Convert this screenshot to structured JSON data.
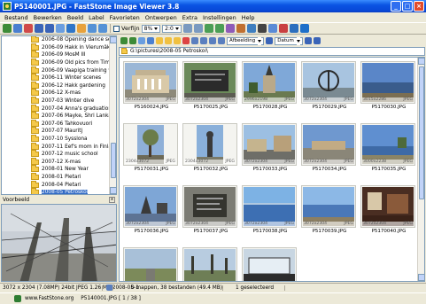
{
  "window": {
    "title": "P5140001.JPG - FastStone Image Viewer 3.8"
  },
  "menu": [
    "Bestand",
    "Bewerken",
    "Beeld",
    "Label",
    "Favorieten",
    "Ontwerpen",
    "Extra",
    "Instellingen",
    "Help"
  ],
  "toolbar": {
    "verfijn_label": "Verfijn",
    "zoom_value": "8%",
    "ratio_value": "2:0"
  },
  "tree": [
    "2006-08 Opening dance season",
    "2006-09 Hakk in Vierumäki",
    "2006-09 MosM III",
    "2006-09 Old pics from Timo's ca",
    "2006-09 Vaapiga training weeke",
    "2006-11 Winter scenes",
    "2006-12 Hakk gardening",
    "2006-12 X-mas",
    "2007-03 Winter dive",
    "2007-04 Anna's graduation",
    "2007-06 Mayke, Shri Lanka",
    "2007-06 Tahkovuori",
    "2007-07 Mauritj",
    "2007-10 Sysslona",
    "2007-11 Eef's mom in Finland",
    "2007-12 music school",
    "2007-12 X-mas",
    "2008-01 New Year",
    "2008-01 Pietari",
    "2008-04 Pietari",
    "2008-05 Petroskoi",
    "2008-05 Pietari"
  ],
  "tree_selected_index": 20,
  "preview_label": "Voorbeeld",
  "sort": {
    "primary": "Afbeelding",
    "secondary": "Datum"
  },
  "path": "G:\\pictures\\2008-05 Petroskoi\\",
  "thumbnails": [
    {
      "name": "P5160024.JPG",
      "dims": "3072x2304",
      "fmt": "JPEG",
      "kind": "building"
    },
    {
      "name": "P5170025.JPG",
      "dims": "3072x2304",
      "fmt": "JPEG",
      "kind": "plaque"
    },
    {
      "name": "P5170028.JPG",
      "dims": "2996x2198",
      "fmt": "JPEG",
      "kind": "church"
    },
    {
      "name": "P5170029.JPG",
      "dims": "3072x2304",
      "fmt": "JPEG",
      "kind": "anchor"
    },
    {
      "name": "P5170030.JPG",
      "dims": "3015x2286",
      "fmt": "JPEG",
      "kind": "lake"
    },
    {
      "name": "P5170031.JPG",
      "dims": "2304x3072",
      "fmt": "JPEG",
      "kind": "tree",
      "portrait": true
    },
    {
      "name": "P5170032.JPG",
      "dims": "2304x3072",
      "fmt": "JPEG",
      "kind": "statue",
      "portrait": true
    },
    {
      "name": "P5170033.JPG",
      "dims": "3072x2304",
      "fmt": "JPEG",
      "kind": "street"
    },
    {
      "name": "P5170034.JPG",
      "dims": "3072x2304",
      "fmt": "JPEG",
      "kind": "square"
    },
    {
      "name": "P5170035.JPG",
      "dims": "3000x2238",
      "fmt": "JPEG",
      "kind": "shore"
    },
    {
      "name": "P5170036.JPG",
      "dims": "3072x2304",
      "fmt": "JPEG",
      "kind": "sculpture"
    },
    {
      "name": "P5170037.JPG",
      "dims": "3072x2304",
      "fmt": "JPEG",
      "kind": "plaque2"
    },
    {
      "name": "P5170038.JPG",
      "dims": "3072x2304",
      "fmt": "JPEG",
      "kind": "water"
    },
    {
      "name": "P5170039.JPG",
      "dims": "3072x2304",
      "fmt": "JPEG",
      "kind": "lake2"
    },
    {
      "name": "P5170040.JPG",
      "dims": "3072x2304",
      "fmt": "JPEG",
      "kind": "interior"
    },
    {
      "name": "",
      "dims": "",
      "fmt": "",
      "kind": "road"
    },
    {
      "name": "",
      "dims": "",
      "fmt": "",
      "kind": "trees"
    },
    {
      "name": "",
      "dims": "",
      "fmt": "",
      "kind": "car"
    }
  ],
  "status": {
    "image_info": "3072 x 2304 (7.08MP)   24bit JPEG   1.26 MB   2008-05-1",
    "folders": "0 mappen, 38 bestanden (49.4 MB)",
    "selected": "1 geselecteerd"
  },
  "footer": {
    "site": "www.FastStone.org",
    "file": "P5140001.JPG  [ 1 / 38 ]"
  }
}
